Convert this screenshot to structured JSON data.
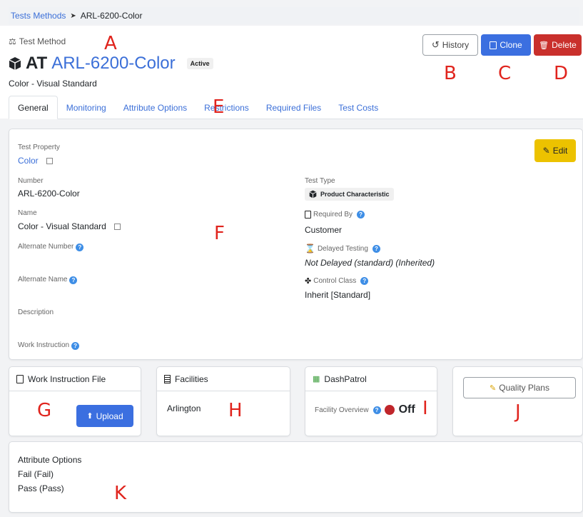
{
  "breadcrumb": {
    "parent": "Tests Methods",
    "current": "ARL-6200-Color"
  },
  "header": {
    "section_label": "Test Method",
    "prefix": "AT",
    "title": "ARL-6200-Color",
    "status": "Active",
    "subtitle": "Color - Visual Standard"
  },
  "actions": {
    "history": "History",
    "clone": "Clone",
    "delete": "Delete"
  },
  "tabs": [
    {
      "label": "General"
    },
    {
      "label": "Monitoring"
    },
    {
      "label": "Attribute Options"
    },
    {
      "label": "Restrictions"
    },
    {
      "label": "Required Files"
    },
    {
      "label": "Test Costs"
    }
  ],
  "general": {
    "edit": "Edit",
    "test_property": {
      "label": "Test Property",
      "value": "Color"
    },
    "number": {
      "label": "Number",
      "value": "ARL-6200-Color"
    },
    "name": {
      "label": "Name",
      "value": "Color - Visual Standard"
    },
    "alternate_number": {
      "label": "Alternate Number"
    },
    "alternate_name": {
      "label": "Alternate Name"
    },
    "description": {
      "label": "Description"
    },
    "work_instruction": {
      "label": "Work Instruction"
    },
    "test_type": {
      "label": "Test Type",
      "value": "Product Characteristic"
    },
    "required_by": {
      "label": "Required By",
      "value": "Customer"
    },
    "delayed_testing": {
      "label": "Delayed Testing",
      "value": "Not Delayed (standard) (Inherited)"
    },
    "control_class": {
      "label": "Control Class",
      "value": "Inherit [Standard]"
    }
  },
  "work_instruction_file": {
    "title": "Work Instruction File",
    "upload": "Upload"
  },
  "facilities": {
    "title": "Facilities",
    "value": "Arlington"
  },
  "dashpatrol": {
    "title": "DashPatrol",
    "label": "Facility Overview",
    "state": "Off",
    "state_color": "#c0262b"
  },
  "quality_plans": {
    "button": "Quality Plans"
  },
  "attribute_options": {
    "title": "Attribute Options",
    "items": [
      "Fail (Fail)",
      "Pass (Pass)"
    ]
  },
  "annotations": {
    "a": "A",
    "b": "B",
    "c": "C",
    "d": "D",
    "e": "E",
    "f": "F",
    "g": "G",
    "h": "H",
    "i": "I",
    "j": "J",
    "k": "K"
  },
  "colors": {
    "link": "#3b6fd8",
    "clone": "#3b6fe0",
    "delete": "#c9302c",
    "edit": "#ecc200",
    "annotation": "#e0241d"
  }
}
